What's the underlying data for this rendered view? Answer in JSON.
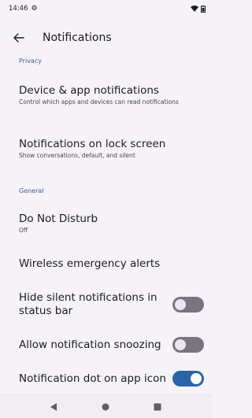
{
  "status_bar": {
    "time": "14:46",
    "settings_icon": "gear-icon",
    "wifi_icon": "wifi-icon",
    "battery_icon": "battery-icon"
  },
  "app_bar": {
    "back_icon": "arrow-back-icon",
    "title": "Notifications"
  },
  "sections": {
    "privacy": "Privacy",
    "general": "General"
  },
  "preferences": {
    "device_app": {
      "title": "Device & app notifications",
      "summary": "Control which apps and devices can read notifications"
    },
    "lock_screen": {
      "title": "Notifications on lock screen",
      "summary": "Show conversations, default, and silent"
    },
    "dnd": {
      "title": "Do Not Disturb",
      "summary": "Off"
    },
    "emergency": {
      "title": "Wireless emergency alerts"
    },
    "hide_silent": {
      "title_line1": "Hide silent notifications in",
      "title_line2": "status bar",
      "enabled": false
    },
    "snooze": {
      "title": "Allow notification snoozing",
      "enabled": false
    },
    "dot": {
      "title": "Notification dot on app icon",
      "enabled": true
    }
  },
  "nav_bar": {
    "back_icon": "nav-back-icon",
    "home_icon": "nav-home-icon",
    "recents_icon": "nav-recents-icon"
  },
  "colors": {
    "background": "#f5f3f7",
    "accent": "#2a64a8",
    "section_header": "#3f5aa8",
    "switch_off": "#79747e"
  }
}
